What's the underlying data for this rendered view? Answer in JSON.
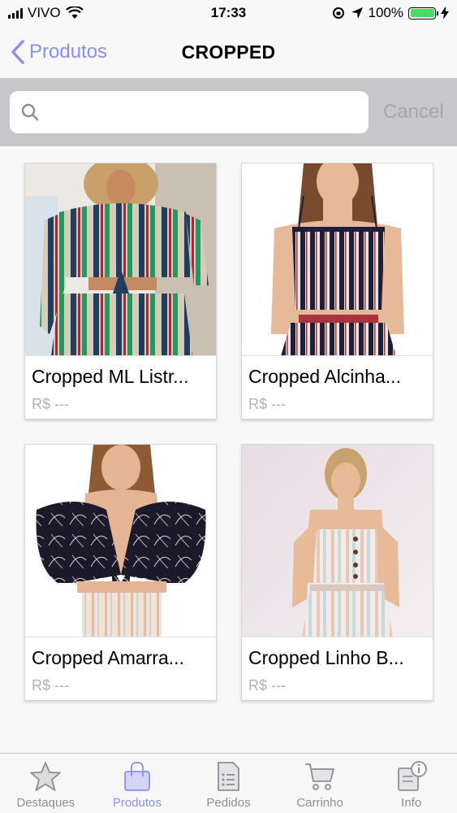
{
  "status_bar": {
    "carrier": "VIVO",
    "time": "17:33",
    "battery": "100%"
  },
  "nav": {
    "back_label": "Produtos",
    "title": "CROPPED"
  },
  "search": {
    "placeholder": "",
    "cancel_label": "Cancel"
  },
  "products": [
    {
      "name": "Cropped ML Listr...",
      "price": "R$ ---"
    },
    {
      "name": "Cropped Alcinha...",
      "price": "R$ ---"
    },
    {
      "name": "Cropped Amarra...",
      "price": "R$ ---"
    },
    {
      "name": "Cropped Linho B...",
      "price": "R$ ---"
    }
  ],
  "tabs": [
    {
      "label": "Destaques",
      "icon": "star-icon"
    },
    {
      "label": "Produtos",
      "icon": "shopping-bag-icon",
      "active": true
    },
    {
      "label": "Pedidos",
      "icon": "document-list-icon"
    },
    {
      "label": "Carrinho",
      "icon": "cart-icon"
    },
    {
      "label": "Info",
      "icon": "info-doc-icon"
    }
  ],
  "colors": {
    "accent": "#8a8fe8",
    "inactive": "#8e8e93",
    "search_bg": "#c6c6cb",
    "battery": "#4cd964"
  }
}
